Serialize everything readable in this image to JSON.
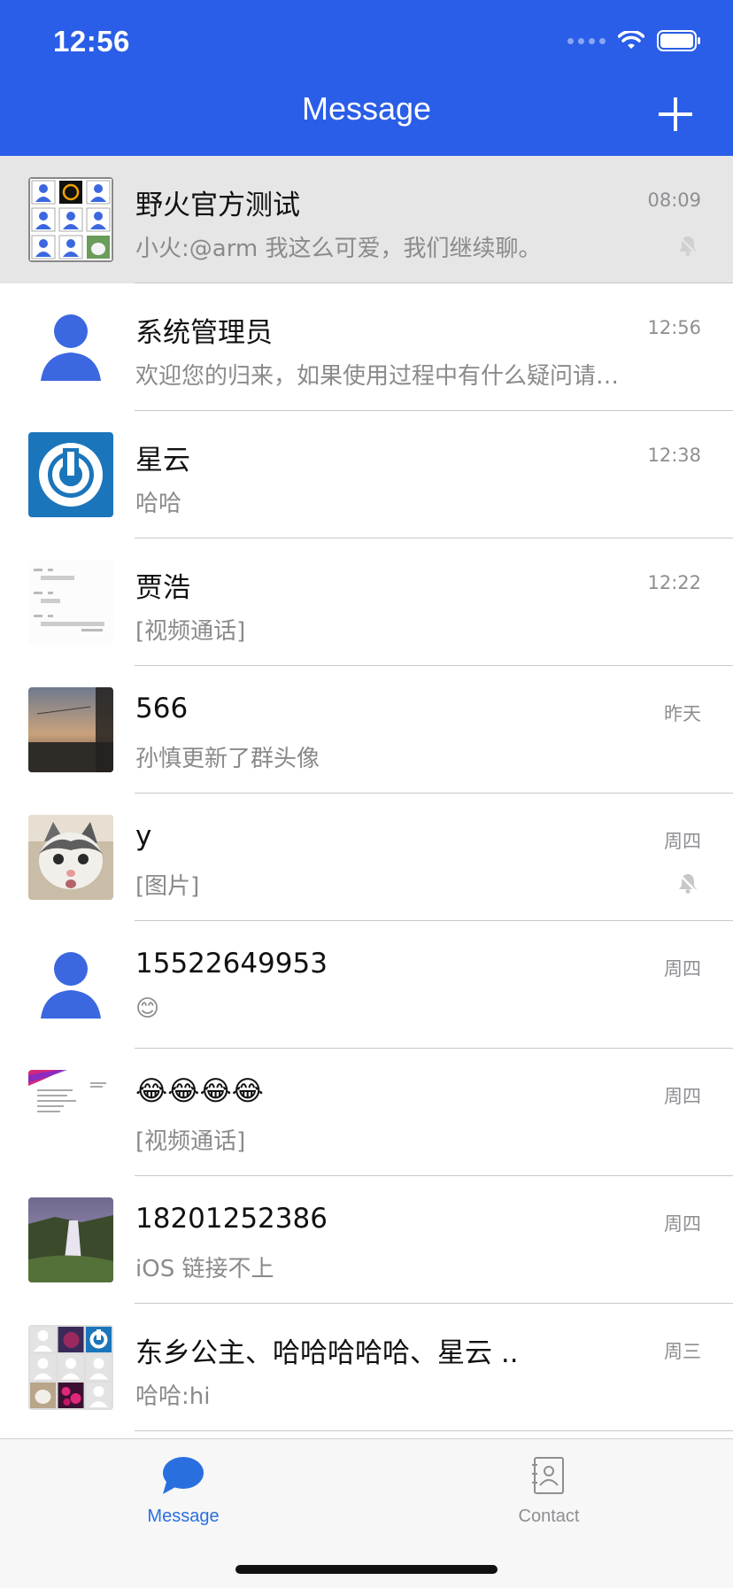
{
  "status_bar": {
    "time": "12:56"
  },
  "nav": {
    "title": "Message"
  },
  "conversations": [
    {
      "name": "野火官方测试",
      "time": "08:09",
      "preview": "小火:@arm 我这么可爱，我们继续聊。",
      "muted": true,
      "pinned": true,
      "avatar": "group-grid-avatar"
    },
    {
      "name": "系统管理员",
      "time": "12:56",
      "preview": "欢迎您的归来，如果使用过程中有什么疑问请…",
      "muted": false,
      "avatar": "default-user-avatar"
    },
    {
      "name": "星云",
      "time": "12:38",
      "preview": "哈哈",
      "muted": false,
      "avatar": "power-logo-avatar"
    },
    {
      "name": "贾浩",
      "time": "12:22",
      "preview": "[视频通话]",
      "muted": false,
      "avatar": "screenshot-avatar"
    },
    {
      "name": "566",
      "time": "昨天",
      "preview": "孙慎更新了群头像",
      "muted": false,
      "avatar": "sunset-photo-avatar"
    },
    {
      "name": "y",
      "time": "周四",
      "preview": "[图片]",
      "muted": true,
      "avatar": "cat-photo-avatar"
    },
    {
      "name": "15522649953",
      "time": "周四",
      "preview": "😊",
      "muted": false,
      "avatar": "default-user-avatar"
    },
    {
      "name": "😂😂😂😂",
      "time": "周四",
      "preview": "[视频通话]",
      "muted": false,
      "avatar": "document-avatar"
    },
    {
      "name": "18201252386",
      "time": "周四",
      "preview": "iOS 链接不上",
      "muted": false,
      "avatar": "waterfall-photo-avatar"
    },
    {
      "name": "东乡公主、哈哈哈哈哈、星云 ..",
      "time": "周三",
      "preview": "哈哈:hi",
      "muted": false,
      "avatar": "group-collage-avatar"
    }
  ],
  "tabbar": {
    "message_label": "Message",
    "contact_label": "Contact"
  },
  "colors": {
    "brand": "#2a5ee8",
    "active_tab": "#2a6fe0",
    "inactive_tab": "#8e8e93"
  }
}
